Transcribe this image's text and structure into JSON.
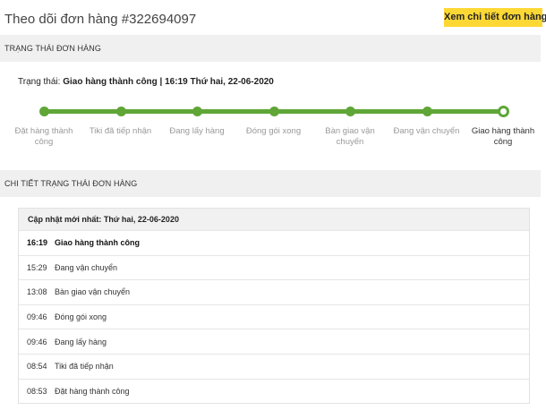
{
  "header": {
    "title": "Theo dõi đơn hàng #322694097",
    "detail_button": "Xem chi tiết đơn hàng"
  },
  "status_section": {
    "heading": "TRẠNG THÁI ĐƠN HÀNG",
    "status_label": "Trạng thái:",
    "status_value": "Giao hàng thành công | 16:19 Thứ hai, 22-06-2020",
    "steps": [
      {
        "label": "Đặt hàng thành công"
      },
      {
        "label": "Tiki đã tiếp nhận"
      },
      {
        "label": "Đang lấy hàng"
      },
      {
        "label": "Đóng gói xong"
      },
      {
        "label": "Bàn giao vận chuyển"
      },
      {
        "label": "Đang vận chuyển"
      },
      {
        "label": "Giao hàng thành công"
      }
    ],
    "completed_steps": 7,
    "total_steps": 7,
    "accent_color": "#5fa637"
  },
  "detail_section": {
    "heading": "CHI TIẾT TRẠNG THÁI ĐƠN HÀNG",
    "last_update": "Cập nhật mới nhất: Thứ hai, 22-06-2020",
    "rows": [
      {
        "time": "16:19",
        "text": "Giao hàng thành công"
      },
      {
        "time": "15:29",
        "text": "Đang vận chuyển"
      },
      {
        "time": "13:08",
        "text": "Bàn giao vận chuyển"
      },
      {
        "time": "09:46",
        "text": "Đóng gói xong"
      },
      {
        "time": "09:46",
        "text": "Đang lấy hàng"
      },
      {
        "time": "08:54",
        "text": "Tiki đã tiếp nhận"
      },
      {
        "time": "08:53",
        "text": "Đặt hàng thành công"
      }
    ]
  }
}
